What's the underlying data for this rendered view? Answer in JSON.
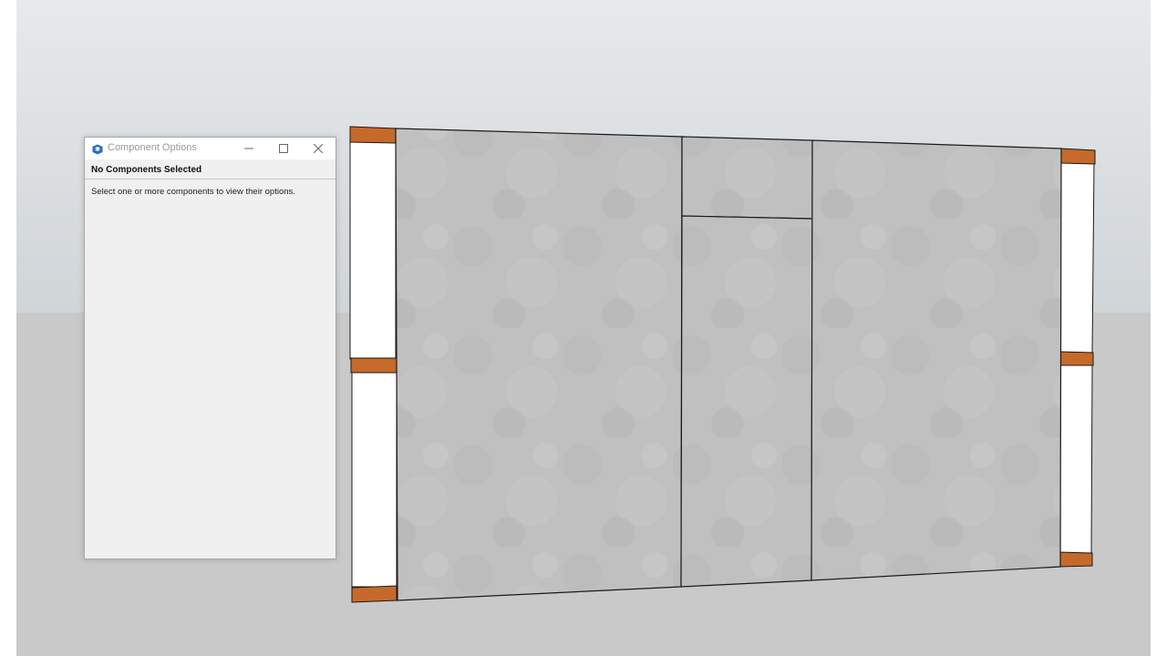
{
  "dialog": {
    "title": "Component Options",
    "heading": "No Components Selected",
    "message": "Select one or more components to view their options.",
    "icons": {
      "app": "sketchup-logo-icon",
      "minimize": "minimize-icon",
      "maximize": "maximize-icon",
      "close": "close-icon"
    }
  },
  "colors": {
    "sky": "#dfe3e5",
    "ground": "#c9c9c9",
    "concrete_panel": "#bfbfbf",
    "stud_face": "#ffffff",
    "wood_block": "#c76a28",
    "edge": "#1a1a1a"
  }
}
